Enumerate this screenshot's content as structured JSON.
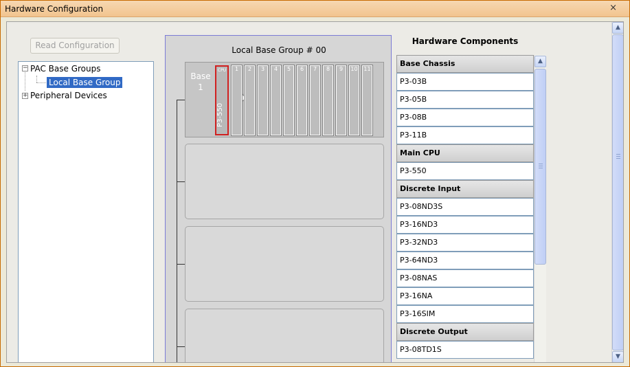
{
  "window": {
    "title": "Hardware Configuration",
    "close": "×"
  },
  "toolbar": {
    "read_label": "Read Configuration"
  },
  "tree": {
    "items": [
      {
        "label": "PAC Base Groups",
        "expander": "−"
      },
      {
        "label": "Local Base Group"
      },
      {
        "label": "Peripheral Devices",
        "expander": "+"
      }
    ]
  },
  "group": {
    "title": "Local Base Group # 00",
    "rack": {
      "base_label_1": "Base",
      "base_label_2": "1",
      "cpu_slot_label": "CPU",
      "cpu_module": "P3-550",
      "slots": [
        "1",
        "2",
        "3",
        "4",
        "5",
        "6",
        "7",
        "8",
        "9",
        "10",
        "11"
      ]
    }
  },
  "components": {
    "title": "Hardware Components",
    "rows": [
      {
        "label": "Base Chassis",
        "header": true
      },
      {
        "label": "P3-03B"
      },
      {
        "label": "P3-05B"
      },
      {
        "label": "P3-08B"
      },
      {
        "label": "P3-11B"
      },
      {
        "label": "Main CPU",
        "header": true
      },
      {
        "label": "P3-550"
      },
      {
        "label": "Discrete Input",
        "header": true
      },
      {
        "label": "P3-08ND3S"
      },
      {
        "label": "P3-16ND3"
      },
      {
        "label": "P3-32ND3"
      },
      {
        "label": "P3-64ND3"
      },
      {
        "label": "P3-08NAS"
      },
      {
        "label": "P3-16NA"
      },
      {
        "label": "P3-16SIM"
      },
      {
        "label": "Discrete Output",
        "header": true
      },
      {
        "label": "P3-08TD1S"
      }
    ]
  },
  "icons": {
    "scroll_up": "▲",
    "scroll_down": "▼",
    "up_chevron": "︿"
  }
}
